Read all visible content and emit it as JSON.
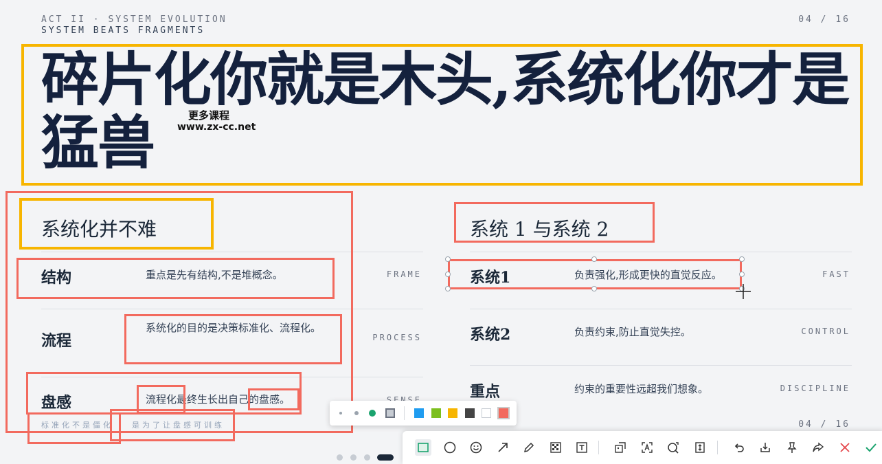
{
  "header": {
    "eyebrow": "ACT II · SYSTEM EVOLUTION",
    "subtitle": "SYSTEM BEATS FRAGMENTS",
    "page": "04 / 16"
  },
  "title": "碎片化你就是木头,系统化你才是猛兽",
  "watermark": {
    "line1": "更多课程",
    "line2": "www.zx-cc.net"
  },
  "left": {
    "heading": "系统化并不难",
    "rows": [
      {
        "label": "结构",
        "desc": "重点是先有结构,不是堆概念。",
        "tag": "FRAME"
      },
      {
        "label": "流程",
        "desc": "系统化的目的是决策标准化、流程化。",
        "tag": "PROCESS"
      },
      {
        "label": "盘感",
        "desc": "流程化最终生长出自己的盘感。",
        "tag": "SENSE"
      }
    ],
    "footer_a": "标准化不是僵化",
    "footer_b": "是为了让盘感可训练"
  },
  "right": {
    "heading": "系统 1 与系统 2",
    "rows": [
      {
        "label": "系统1",
        "desc": "负责强化,形成更快的直觉反应。",
        "tag": "FAST"
      },
      {
        "label": "系统2",
        "desc": "负责约束,防止直觉失控。",
        "tag": "CONTROL"
      },
      {
        "label": "重点",
        "desc": "约束的重要性远超我们想象。",
        "tag": "DISCIPLINE"
      }
    ],
    "page": "04 / 16"
  },
  "palette": {
    "sizes": [
      "small",
      "medium",
      "large"
    ],
    "selected_size_color": "#1aa36e",
    "colors": [
      "#1f9cf0",
      "#7cbf1e",
      "#f7b500",
      "#444444",
      "#ffffff",
      "#f26a5e"
    ],
    "selected_color": "#f26a5e"
  },
  "toolbar": {
    "tools": [
      "rectangle-icon",
      "ellipse-icon",
      "emoji-icon",
      "arrow-icon",
      "pen-icon",
      "mosaic-icon",
      "text-icon",
      "pin-image-icon",
      "ocr-icon",
      "translate-icon",
      "scroll-capture-icon",
      "undo-icon",
      "save-icon",
      "pin-icon",
      "share-icon",
      "cancel-icon",
      "confirm-icon"
    ],
    "active_tool": "rectangle-icon"
  },
  "pager": {
    "total": 4,
    "active": 4
  }
}
